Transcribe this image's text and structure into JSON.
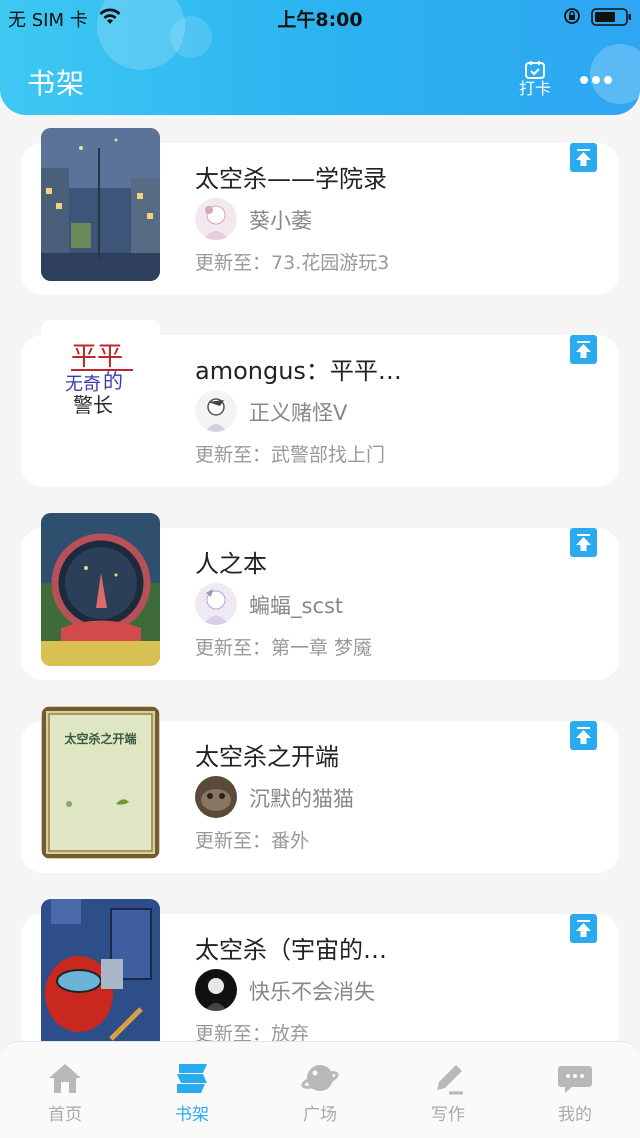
{
  "status_bar": {
    "carrier": "无 SIM 卡",
    "time": "上午8:00"
  },
  "header": {
    "title": "书架",
    "checkin_label": "打卡",
    "accent_color": "#2bb4f0"
  },
  "books": [
    {
      "title": "太空杀——学院录",
      "author": "葵小萎",
      "update": "更新至：73.花园游玩3",
      "cover_icon": "night-street-cover"
    },
    {
      "title": "amongus：平平…",
      "author": "正义赌怪V",
      "update": "更新至：武警部找上门",
      "cover_icon": "calligraphy-cover"
    },
    {
      "title": "人之本",
      "author": "蝙蝠_scst",
      "update": "更新至：第一章 梦魇",
      "cover_icon": "space-helmet-cover"
    },
    {
      "title": "太空杀之开端",
      "author": "沉默的猫猫",
      "update": "更新至：番外",
      "cover_icon": "framed-text-cover",
      "cover_text": "太空杀之开端"
    },
    {
      "title": "太空杀（宇宙的…",
      "author": "快乐不会消失",
      "update": "更新至：放弃",
      "cover_icon": "crewmate-cover"
    }
  ],
  "tabs": [
    {
      "label": "首页",
      "icon": "home-icon"
    },
    {
      "label": "书架",
      "icon": "bookshelf-icon",
      "active": true
    },
    {
      "label": "广场",
      "icon": "planet-icon"
    },
    {
      "label": "写作",
      "icon": "pen-icon"
    },
    {
      "label": "我的",
      "icon": "chat-bubble-icon"
    }
  ]
}
